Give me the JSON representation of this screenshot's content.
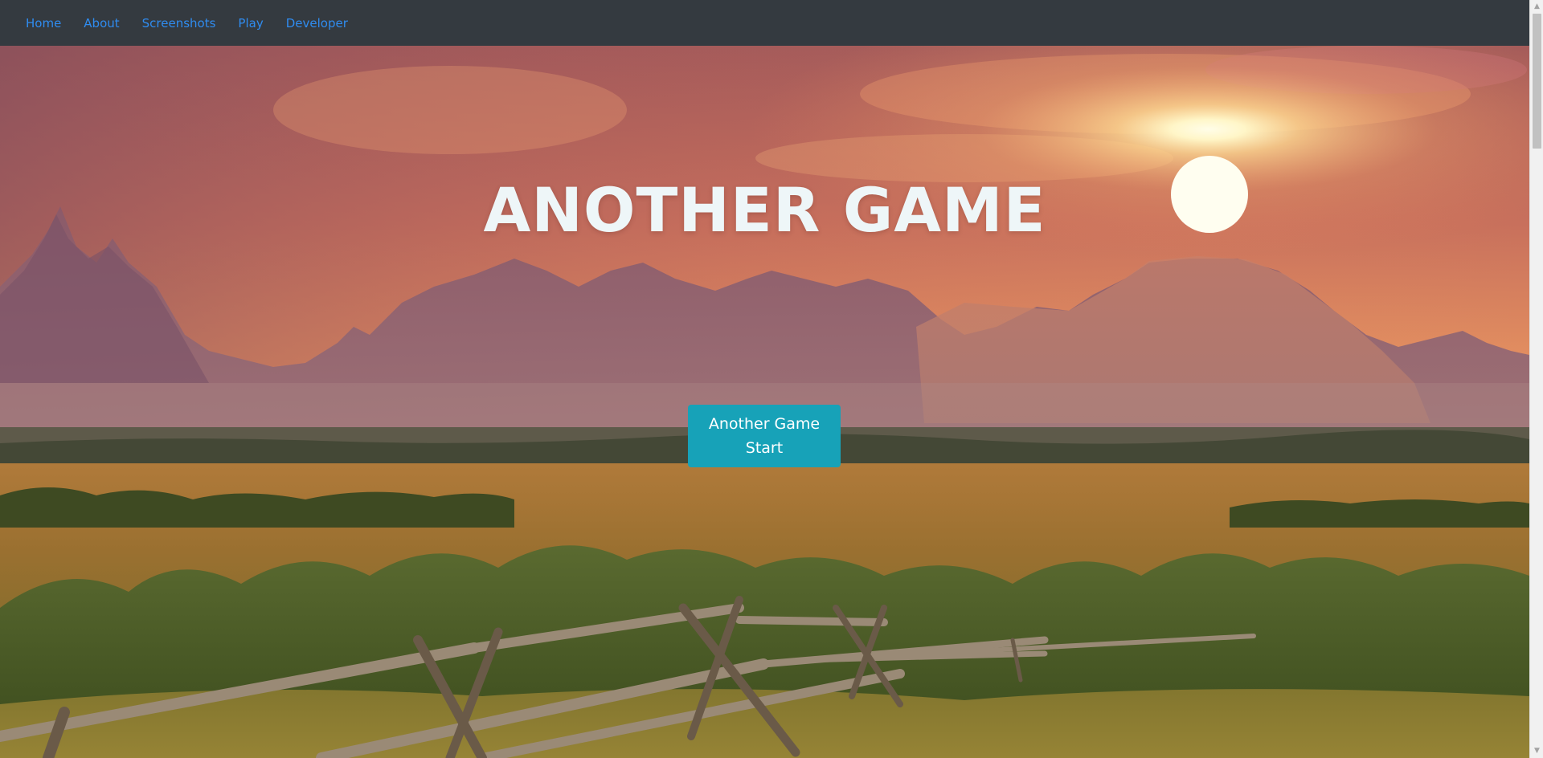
{
  "nav": {
    "items": [
      {
        "label": "Home"
      },
      {
        "label": "About"
      },
      {
        "label": "Screenshots"
      },
      {
        "label": "Play"
      },
      {
        "label": "Developer"
      }
    ]
  },
  "hero": {
    "title": "ANOTHER GAME",
    "button_label": "Another Game Start",
    "background": "sunset-mountain-meadow-image"
  },
  "colors": {
    "navbar": "#343a40",
    "nav_link": "#2f8cf0",
    "button": "#17a2b8",
    "title": "#eef6f8"
  }
}
